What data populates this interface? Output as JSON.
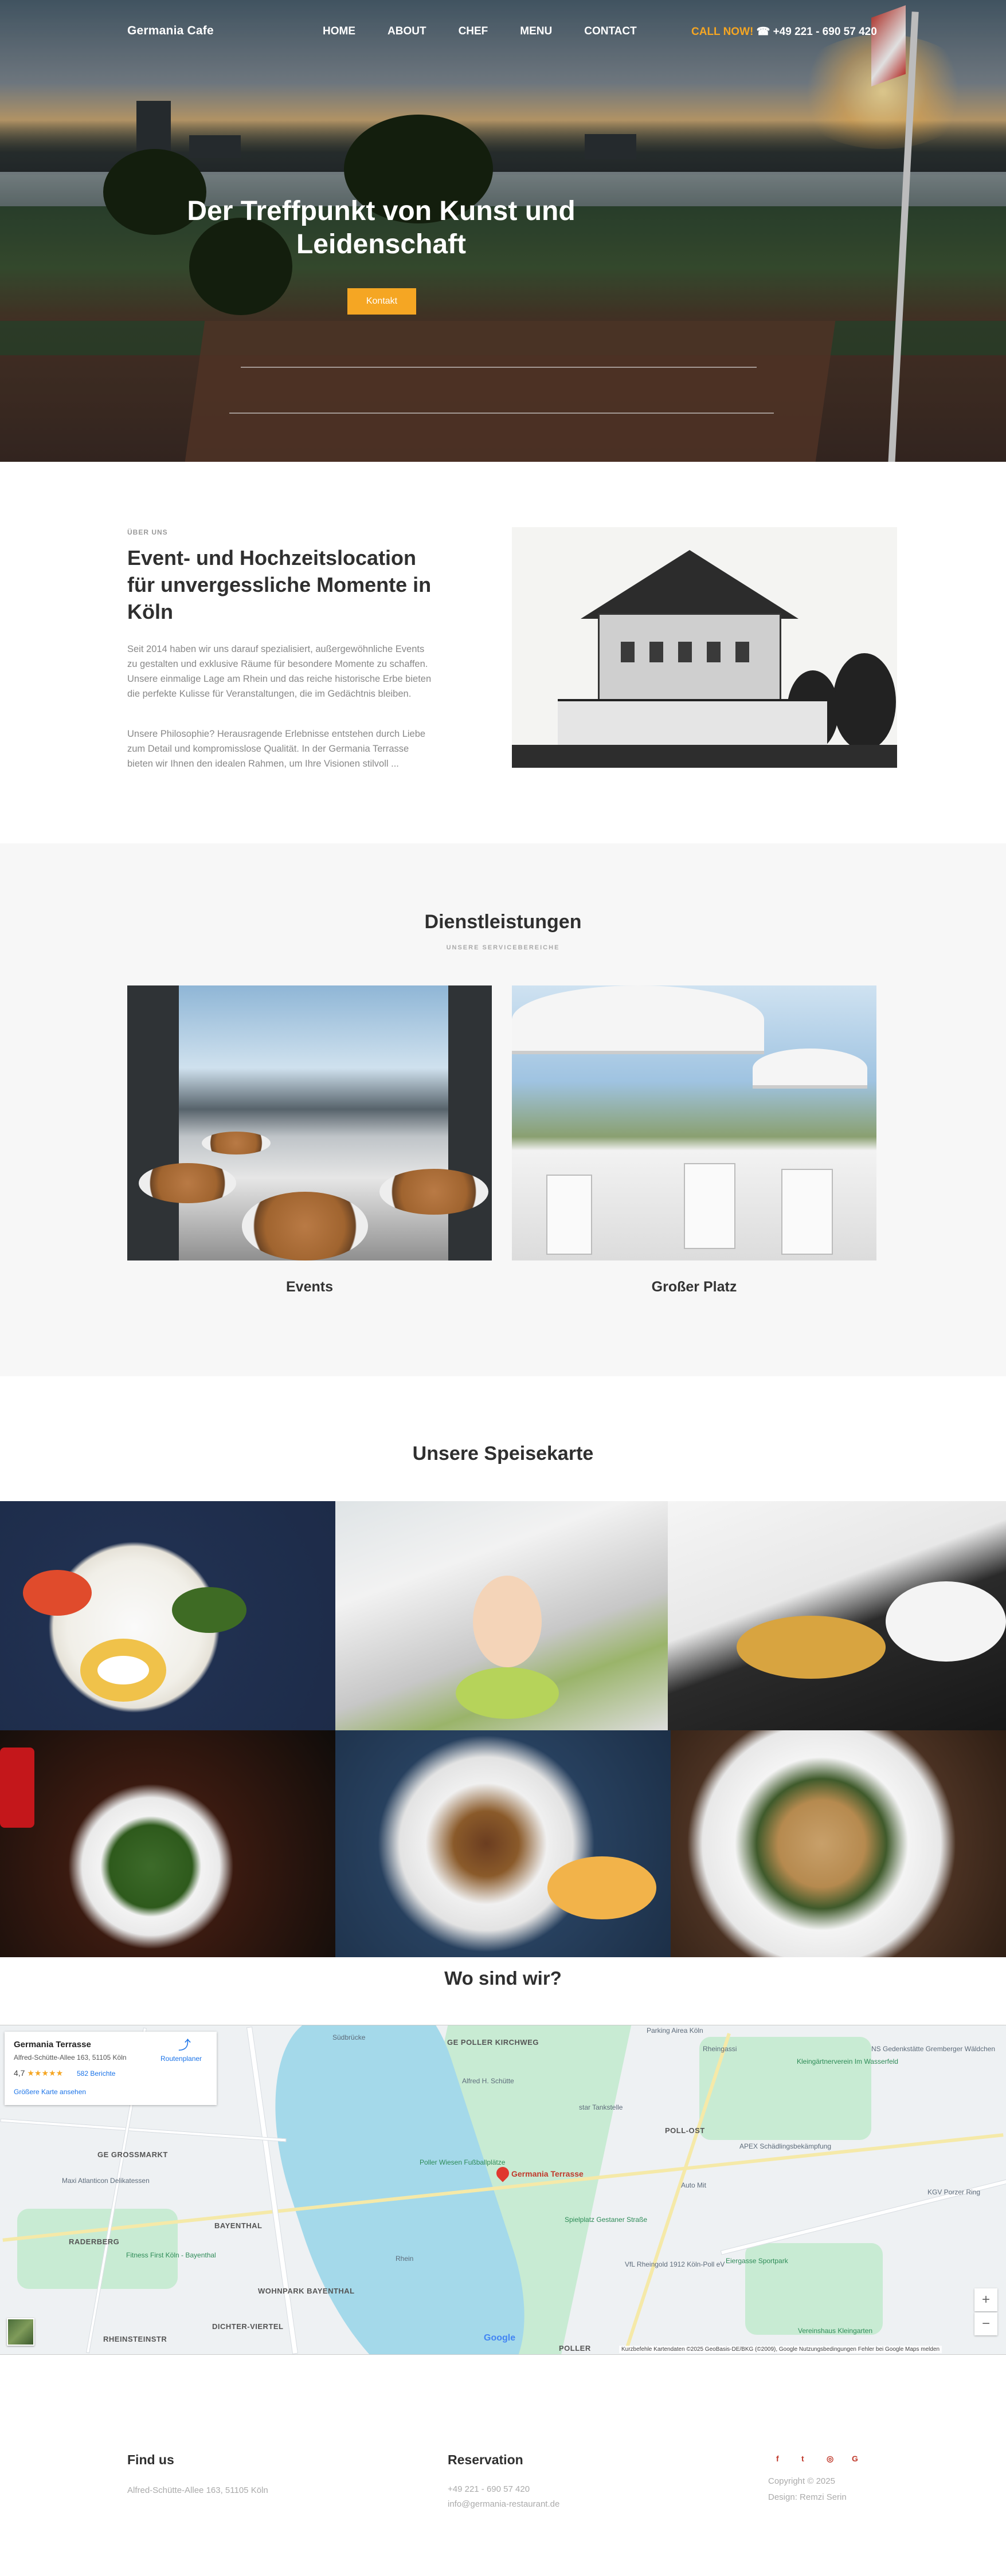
{
  "nav": {
    "brand": "Germania   Cafe",
    "links": [
      "HOME",
      "ABOUT",
      "CHEF",
      "MENU",
      "CONTACT"
    ],
    "call_label": "CALL NOW!",
    "phone": "☎ +49 221 - 690 57 420"
  },
  "hero": {
    "title": "Der Treffpunkt von Kunst und Leidenschaft",
    "button": "Kontakt"
  },
  "about": {
    "kicker": "ÜBER UNS",
    "title": "Event- und Hochzeitslocation für unvergessliche Momente in Köln",
    "p1": "Seit 2014 haben wir uns darauf spezialisiert, außergewöhnliche Events zu gestalten und exklusive Räume für besondere Momente zu schaffen. Unsere einmalige Lage am Rhein und das reiche historische Erbe bieten die perfekte Kulisse für Veranstaltungen, die im Gedächtnis bleiben.",
    "p2": "Unsere Philosophie? Herausragende Erlebnisse entstehen durch Liebe zum Detail und kompromisslose Qualität. In der Germania Terrasse bieten wir Ihnen den idealen Rahmen, um Ihre Visionen stilvoll ..."
  },
  "services": {
    "title": "Dienstleistungen",
    "subtitle": "UNSERE SERVICEBEREICHE",
    "items": [
      {
        "label": "Events"
      },
      {
        "label": "Großer Platz"
      }
    ]
  },
  "menu": {
    "title": "Unsere Speisekarte"
  },
  "location": {
    "title": "Wo sind wir?",
    "card": {
      "name": "Germania Terrasse",
      "address": "Alfred-Schütte-Allee 163, 51105 Köln",
      "rating": "4,7",
      "stars": "★★★★★",
      "reviews": "582 Berichte",
      "bigger_map": "Größere Karte ansehen",
      "route": "Routenplaner"
    },
    "pin_label": "Germania Terrasse",
    "labels": {
      "poller_kirchweg": "GE POLLER KIRCHWEG",
      "grossmarkt": "GE GROSSMARKT",
      "raderberg": "RADERBERG",
      "bayenthal": "BAYENTHAL",
      "wohnpark": "WOHNPARK BAYENTHAL",
      "dichter": "DICHTER-VIERTEL",
      "rheinstein": "RHEINSTEINSTR",
      "poll_ost": "POLL-OST",
      "poller": "POLLER",
      "parking": "Parking Airea Köln",
      "rheingassi": "Rheingassi",
      "kleingarten": "Kleingärtnerverein Im Wasserfeld",
      "ns": "NS Gedenkstätte Gremberger Wäldchen",
      "alfred": "Alfred H. Schütte",
      "apex": "APEX Schädlingsbekämpfung",
      "auto": "Auto Mit",
      "kgv": "KGV Porzer Ring",
      "spielplatz": "Spielplatz Gestaner Straße",
      "vfl": "VfL Rheingold 1912 Köln-Poll eV",
      "fitness": "Fitness First Köln - Bayenthal",
      "maxi": "Maxi Atlanticon Delikatessen",
      "soedbr": "Südbrücke",
      "bootsfl": "Poller Wiesen Fußballplätze",
      "tankstelle": "star Tankstelle",
      "eiergasse": "Eiergasse Sportpark",
      "verein": "Vereinshaus Kleingarten",
      "rhein": "Rhein"
    },
    "google": "Google",
    "attribution": "Kurzbefehle   Kartendaten ©2025 GeoBasis-DE/BKG (©2009), Google   Nutzungsbedingungen   Fehler bei Google Maps melden",
    "zoom_in": "+",
    "zoom_out": "−"
  },
  "footer": {
    "find_title": "Find us",
    "address": "Alfred-Schütte-Allee 163, 51105 Köln",
    "res_title": "Reservation",
    "phone": "+49 221 - 690 57 420",
    "email": "info@germania-restaurant.de",
    "social": [
      "f",
      "t",
      "◎",
      "G"
    ],
    "copyright": "Copyright © 2025",
    "design": "Design: Remzi Serin"
  },
  "colors": {
    "accent": "#f5a623",
    "heading": "#2f2f2f",
    "muted": "#888888",
    "services_bg": "#f7f7f7"
  }
}
